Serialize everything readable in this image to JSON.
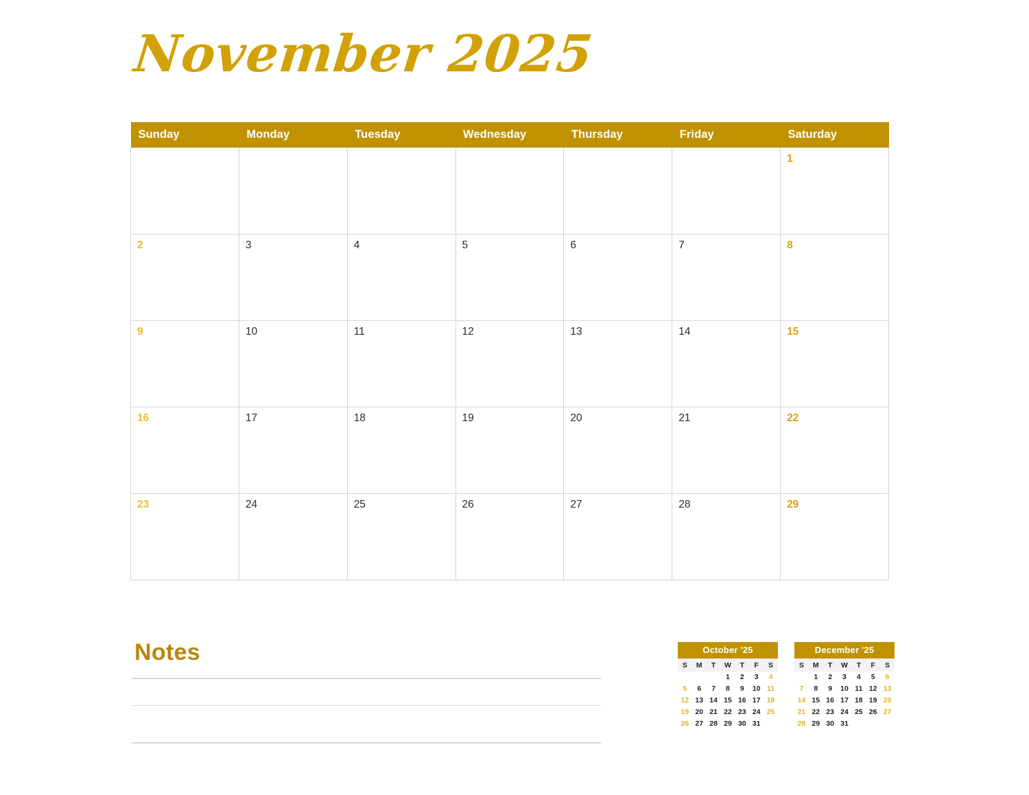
{
  "title": "November 2025",
  "colors": {
    "header_bg": "#C19200",
    "header_text": "#FFFFFF",
    "weekend_date": "#EFBE26",
    "saturday_date": "#D9A40E",
    "weekday_date": "#2B2B2B",
    "title_gold": "#D2A106",
    "notes_gold": "#B8860B",
    "grid_line": "#D4D4D4"
  },
  "weekday_headers": [
    "Sunday",
    "Monday",
    "Tuesday",
    "Wednesday",
    "Thursday",
    "Friday",
    "Saturday"
  ],
  "weeks": [
    [
      "",
      "",
      "",
      "",
      "",
      "",
      "1"
    ],
    [
      "2",
      "3",
      "4",
      "5",
      "6",
      "7",
      "8"
    ],
    [
      "9",
      "10",
      "11",
      "12",
      "13",
      "14",
      "15"
    ],
    [
      "16",
      "17",
      "18",
      "19",
      "20",
      "21",
      "22"
    ],
    [
      "23",
      "24",
      "25",
      "26",
      "27",
      "28",
      "29"
    ]
  ],
  "notes": {
    "title": "Notes",
    "line_count": 3
  },
  "mini_calendars": [
    {
      "id": "prev",
      "title": "October '25",
      "dow": [
        "S",
        "M",
        "T",
        "W",
        "T",
        "F",
        "S"
      ],
      "weeks": [
        [
          "",
          "",
          "",
          "1",
          "2",
          "3",
          "4"
        ],
        [
          "5",
          "6",
          "7",
          "8",
          "9",
          "10",
          "11"
        ],
        [
          "12",
          "13",
          "14",
          "15",
          "16",
          "17",
          "18"
        ],
        [
          "19",
          "20",
          "21",
          "22",
          "23",
          "24",
          "25"
        ],
        [
          "26",
          "27",
          "28",
          "29",
          "30",
          "31",
          ""
        ]
      ]
    },
    {
      "id": "next",
      "title": "December '25",
      "dow": [
        "S",
        "M",
        "T",
        "W",
        "T",
        "F",
        "S"
      ],
      "weeks": [
        [
          "",
          "1",
          "2",
          "3",
          "4",
          "5",
          "6"
        ],
        [
          "7",
          "8",
          "9",
          "10",
          "11",
          "12",
          "13"
        ],
        [
          "14",
          "15",
          "16",
          "17",
          "18",
          "19",
          "20"
        ],
        [
          "21",
          "22",
          "23",
          "24",
          "25",
          "26",
          "27"
        ],
        [
          "28",
          "29",
          "30",
          "31",
          "",
          "",
          ""
        ]
      ]
    }
  ]
}
